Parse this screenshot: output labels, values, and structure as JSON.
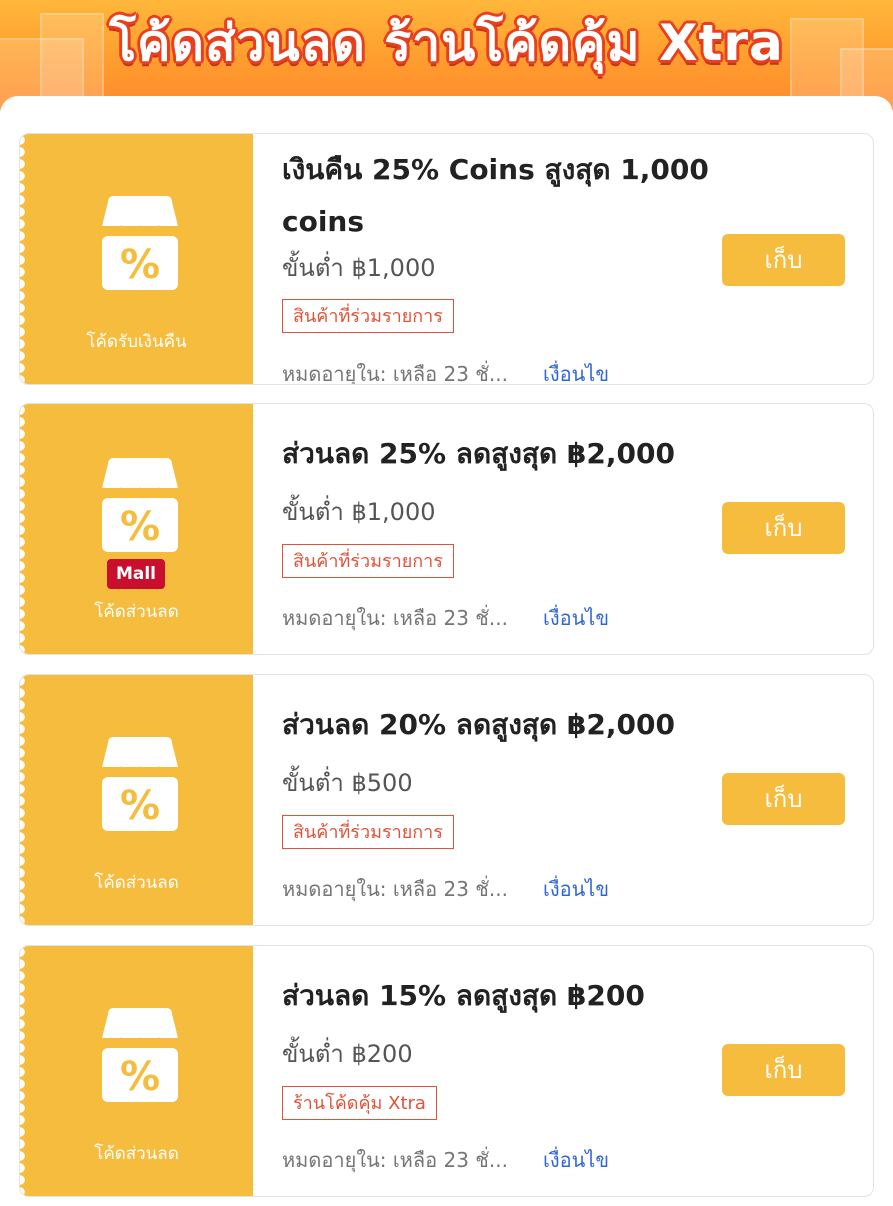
{
  "banner": {
    "title": "โค้ดส่วนลด ร้านโค้ดคุ้ม Xtra"
  },
  "colors": {
    "accent": "#f5bc3e",
    "banner_orange": "#ff9a2e",
    "title_outline": "#e8401f",
    "tag_red": "#e0533a",
    "link_blue": "#3066d6",
    "mall_red": "#c8102e"
  },
  "coupons": [
    {
      "icon": "shop-percent-icon",
      "stub_label": "โค้ดรับเงินคืน",
      "title": "เงินคืน 25% Coins สูงสุด 1,000 coins",
      "min_spend": "ขั้นต่ำ ฿1,000",
      "tag": "สินค้าที่ร่วมรายการ",
      "expiry": "หมดอายุใน: เหลือ 23 ชั่...",
      "condition_link": "เงื่อนไข",
      "button_label": "เก็บ"
    },
    {
      "icon": "shop-percent-icon",
      "badge": "Mall",
      "stub_label": "โค้ดส่วนลด",
      "title": "ส่วนลด 25% ลดสูงสุด ฿2,000",
      "min_spend": "ขั้นต่ำ ฿1,000",
      "tag": "สินค้าที่ร่วมรายการ",
      "expiry": "หมดอายุใน: เหลือ 23 ชั่...",
      "condition_link": "เงื่อนไข",
      "button_label": "เก็บ"
    },
    {
      "icon": "shop-percent-icon",
      "stub_label": "โค้ดส่วนลด",
      "title": "ส่วนลด 20% ลดสูงสุด ฿2,000",
      "min_spend": "ขั้นต่ำ ฿500",
      "tag": "สินค้าที่ร่วมรายการ",
      "expiry": "หมดอายุใน: เหลือ 23 ชั่...",
      "condition_link": "เงื่อนไข",
      "button_label": "เก็บ"
    },
    {
      "icon": "shop-percent-icon",
      "stub_label": "โค้ดส่วนลด",
      "title": "ส่วนลด 15% ลดสูงสุด ฿200",
      "min_spend": "ขั้นต่ำ ฿200",
      "tag": "ร้านโค้ดคุ้ม Xtra",
      "expiry": "หมดอายุใน: เหลือ 23 ชั่...",
      "condition_link": "เงื่อนไข",
      "button_label": "เก็บ"
    }
  ]
}
